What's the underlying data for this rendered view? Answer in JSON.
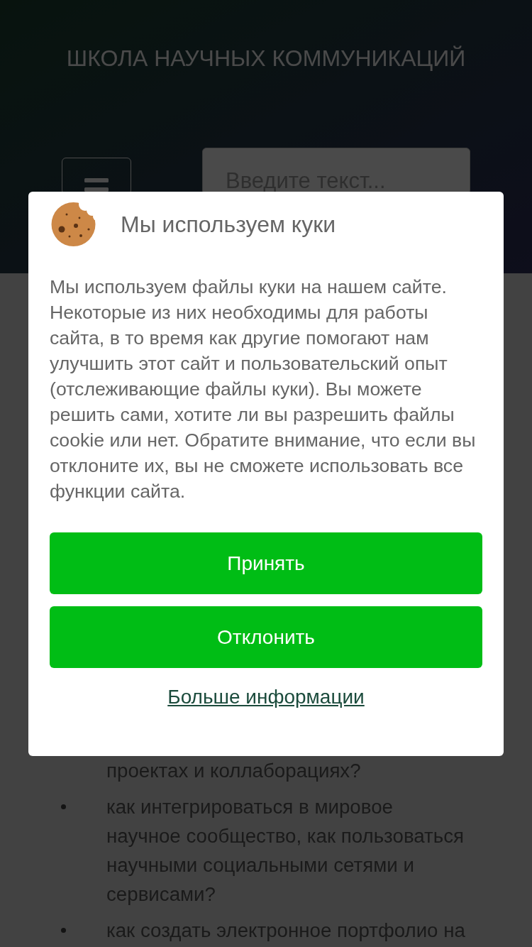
{
  "header": {
    "title": "ШКОЛА НАУЧНЫХ КОММУНИКАЦИЙ",
    "search": {
      "placeholder": "Введите текст..."
    }
  },
  "content": {
    "list": [
      {
        "kind": "continuation",
        "text": "проектах и коллаборациях?"
      },
      {
        "kind": "bullet",
        "text": "как интегрироваться в мировое научное сообщество, как пользоваться научными социальными сетями и сервисами?"
      },
      {
        "kind": "bullet",
        "text": "как создать электронное портфолио на"
      }
    ]
  },
  "cookie_dialog": {
    "title": "Мы используем куки",
    "text": "Мы используем файлы куки на нашем сайте. Некоторые из них необходимы для работы сайта, в то время как другие помогают нам улучшить этот сайт и пользовательский опыт (отслеживающие файлы куки). Вы можете решить сами, хотите ли вы разрешить файлы cookie или нет. Обратите внимание, что если вы отклоните их, вы не сможете использовать все функции сайта.",
    "buttons": [
      "Принять",
      "Отклонить"
    ],
    "link": "Больше информации"
  }
}
